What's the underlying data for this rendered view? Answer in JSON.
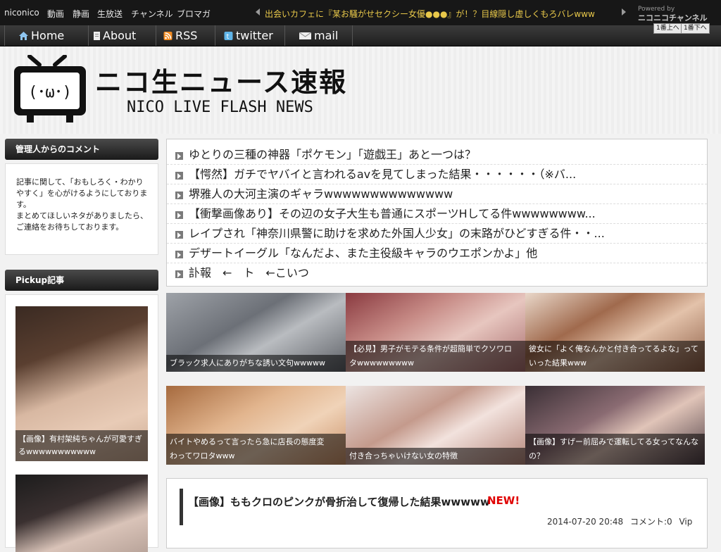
{
  "topbar": {
    "nav_links": [
      "niconico",
      "動画",
      "静画",
      "生放送",
      "チャンネル",
      "ブロマガ"
    ],
    "ticker": "出会いカフェに『某お騒がせセクシー女優●●●』が！？目線隠し虚しくもろバレwww",
    "powered_by": "Powered by",
    "channel_logo": "ニコニコチャンネル",
    "page_first": "1番上へ",
    "page_last": "1番下へ"
  },
  "nav": {
    "items": [
      {
        "label": "Home",
        "icon": "home-icon"
      },
      {
        "label": "About",
        "icon": "document-icon"
      },
      {
        "label": "RSS",
        "icon": "rss-icon"
      },
      {
        "label": "twitter",
        "icon": "twitter-icon"
      },
      {
        "label": "mail",
        "icon": "mail-icon"
      }
    ]
  },
  "header": {
    "title": "ニコ生ニュース速報",
    "subtitle": "NICO LIVE FLASH NEWS",
    "mascot_face": "(･ω･)"
  },
  "sidebar": {
    "comment_heading": "管理人からのコメント",
    "comment_lines": [
      "記事に関して、「おもしろく・わかり",
      "やすく」を心がけるようにしておりま",
      "す。",
      "まとめてほしいネタがありましたら、",
      "ご連絡をお待ちしております。"
    ],
    "pickup_heading": "Pickup記事",
    "pickups": [
      {
        "caption_lines": [
          "【画像】有村架純ちゃんが可愛すぎ",
          "るwwwwwwwwwww"
        ]
      }
    ]
  },
  "headlines": [
    "ゆとりの三種の神器「ポケモン」「遊戯王」あと一つは？",
    "【愕然】ガチでヤバイと言われるavを見てしまった結果・・・・・・（※バ...",
    "堺雅人の大河主演のギャラwwwwwwwwwwwwww",
    "【衝撃画像あり】その辺の女子大生も普通にスポーツHしてる件wwwwwwww...",
    "レイプされ「神奈川県警に助けを求めた外国人少女」の末路がひどすぎる件・・...",
    "デザートイーグル「なんだよ、また主役級キャラのウエポンかよ」他",
    "訃報　←　ト　←こいつ"
  ],
  "thumbs": [
    {
      "caption_lines": [
        "ブラック求人にありがちな誘い文句wwwww"
      ],
      "color": "#7b7f86"
    },
    {
      "caption_lines": [
        "【必見】男子がモテる条件が超簡単でクソワロ",
        "タwwwwwwwww"
      ],
      "color": "#b77b7a"
    },
    {
      "caption_lines": [
        "彼女に「よく俺なんかと付き合ってるよな」って",
        "いった結果www"
      ],
      "color": "#c8a38e"
    },
    {
      "caption_lines": [
        "バイトやめるって言ったら急に店長の態度変",
        "わってワロタwww"
      ],
      "color": "#c99a7e"
    },
    {
      "caption_lines": [
        "付き合っちゃいけない女の特徴"
      ],
      "color": "#d8b9b2"
    },
    {
      "caption_lines": [
        "【画像】すげー前屈みで運転してる女ってなんな",
        "の？"
      ],
      "color": "#6e5a63"
    }
  ],
  "article": {
    "title": "【画像】ももクロのピンクが骨折治して復帰した結果wwwww",
    "badge": "NEW!",
    "date": "2014-07-20 20:48",
    "comments": "コメント:0",
    "author": "Vip"
  },
  "colors": {
    "topbar_bg": "#171717",
    "ticker_text": "#e8c84a",
    "nav_bg": "#2a2a2a",
    "new_badge": "#e00000"
  }
}
